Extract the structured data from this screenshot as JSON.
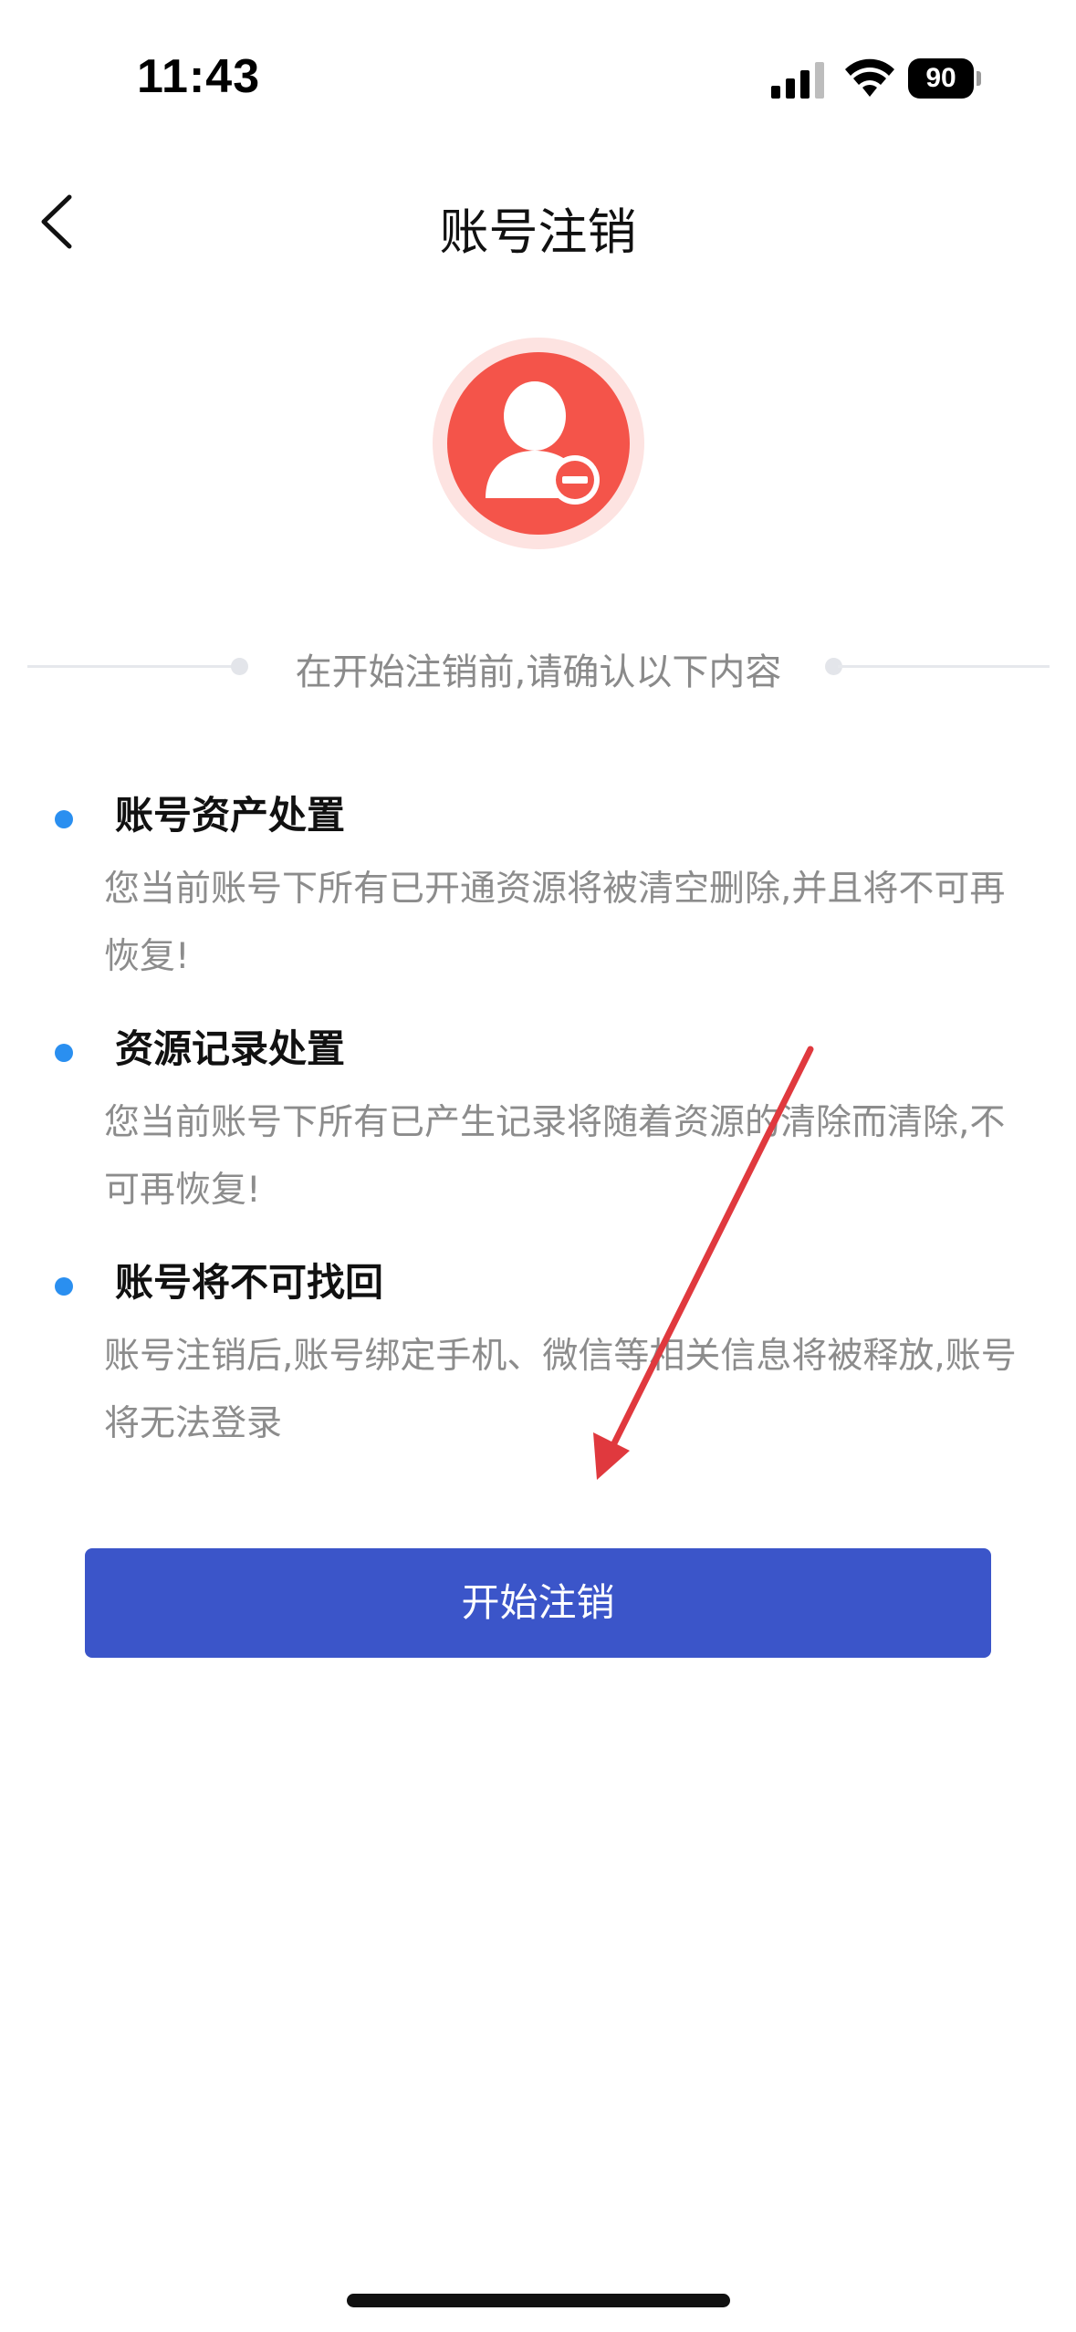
{
  "status_bar": {
    "time": "11:43",
    "battery_level": "90",
    "icons": [
      "signal-icon",
      "wifi-icon",
      "battery-icon"
    ]
  },
  "nav": {
    "title": "账号注销",
    "back_icon": "chevron-left-icon"
  },
  "avatar": {
    "icon": "user-remove-icon",
    "color": "#f4544a",
    "halo_color": "#fde3e1"
  },
  "section": {
    "heading": "在开始注销前,请确认以下内容"
  },
  "items": [
    {
      "title": "账号资产处置",
      "desc": "您当前账号下所有已开通资源将被清空删除,并且将不可再恢复!"
    },
    {
      "title": "资源记录处置",
      "desc": "您当前账号下所有已产生记录将随着资源的清除而清除,不可再恢复!"
    },
    {
      "title": "账号将不可找回",
      "desc": "账号注销后,账号绑定手机、微信等相关信息将被释放,账号将无法登录"
    }
  ],
  "colors": {
    "accent": "#3b55c9",
    "bullet": "#2a8ff0",
    "annotation": "#e0393e"
  },
  "button": {
    "label": "开始注销"
  }
}
